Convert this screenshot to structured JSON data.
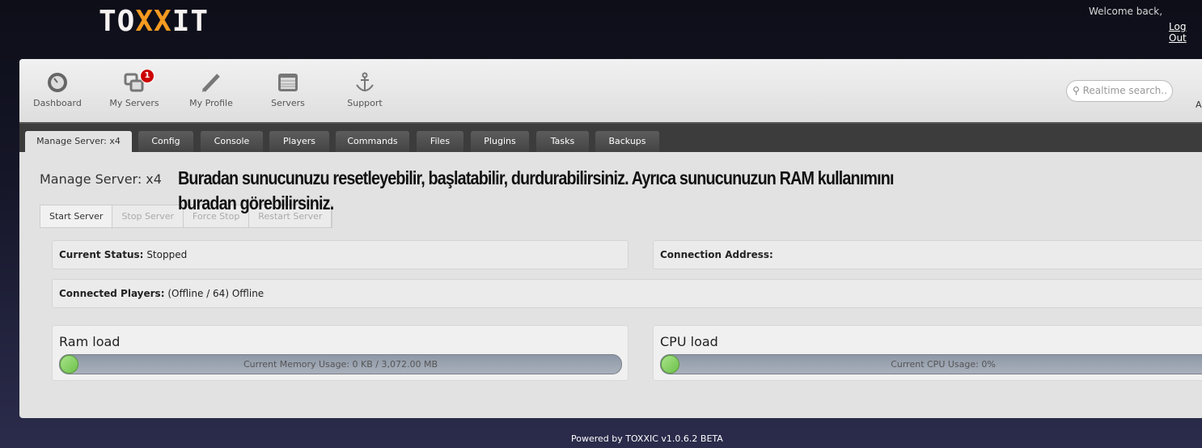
{
  "brand": {
    "logo_pre": "TO",
    "logo_mid": "XX",
    "logo_post": "IT"
  },
  "user": {
    "welcome": "Welcome back,",
    "logout": "Log Out"
  },
  "nav": [
    {
      "label": "Dashboard",
      "icon": "dashboard-gauge-icon"
    },
    {
      "label": "My Servers",
      "icon": "servers-windows-icon",
      "badge": "1"
    },
    {
      "label": "My Profile",
      "icon": "pencil-icon"
    },
    {
      "label": "Servers",
      "icon": "list-table-icon"
    },
    {
      "label": "Support",
      "icon": "anchor-icon"
    }
  ],
  "search": {
    "placeholder": "Realtime search.."
  },
  "nav_cut": "A",
  "tabs": [
    "Manage Server: x4",
    "Config",
    "Console",
    "Players",
    "Commands",
    "Files",
    "Plugins",
    "Tasks",
    "Backups"
  ],
  "page_title": "Manage Server: x4",
  "annotation": "Buradan sunucunuzu resetleyebilir, başlatabilir, durdurabilirsiniz. Ayrıca sunucunuzun RAM kullanımını buradan görebilirsiniz.",
  "actions": [
    "Start Server",
    "Stop Server",
    "Force Stop",
    "Restart Server"
  ],
  "status": {
    "label": "Current Status:",
    "value": "Stopped"
  },
  "address": {
    "label": "Connection Address:",
    "value": ""
  },
  "players": {
    "label": "Connected Players:",
    "value": "(Offline / 64) Offline"
  },
  "ram": {
    "title": "Ram load",
    "text": "Current Memory Usage: 0 KB / 3,072.00 MB",
    "percent": 0
  },
  "cpu": {
    "title": "CPU load",
    "text": "Current CPU Usage: 0%",
    "percent": 0
  },
  "footer": "Powered by TOXXIC v1.0.6.2 BETA",
  "colors": {
    "accent": "#f39a21",
    "badge": "#cc0000",
    "progress": "#6cc04a"
  }
}
